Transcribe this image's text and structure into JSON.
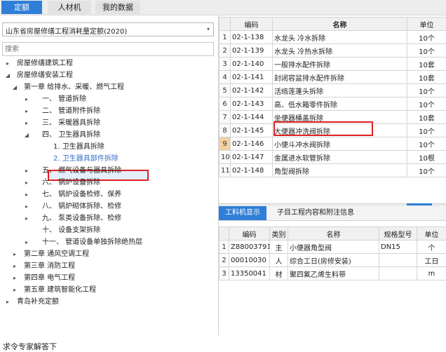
{
  "top_tabs": [
    "定额",
    "人材机",
    "我的数据"
  ],
  "left": {
    "quota_library": "山东省房屋修缮工程消耗量定额(2020)",
    "search_placeholder": "搜索",
    "tree": [
      {
        "label": "房屋修缮建筑工程",
        "toggle": "▸"
      },
      {
        "label": "房屋修缮安装工程",
        "toggle": "◢"
      },
      {
        "label": "第一章 给排水、采暖、燃气工程",
        "toggle": "◢"
      },
      {
        "label": "一、 管道拆除",
        "toggle": "▸"
      },
      {
        "label": "二、 管道附件拆除",
        "toggle": "▸"
      },
      {
        "label": "三、 采暖器具拆除",
        "toggle": "▸"
      },
      {
        "label": "四、 卫生器具拆除",
        "toggle": "◢"
      },
      {
        "label": "1. 卫生器具拆除",
        "toggle": ""
      },
      {
        "label": "2. 卫生器具部件拆除",
        "toggle": ""
      },
      {
        "label": "五、 燃气设备与器具拆除",
        "toggle": "▸"
      },
      {
        "label": "六、 锅炉设备拆除",
        "toggle": "▸"
      },
      {
        "label": "七、 锅炉设备检修、保养",
        "toggle": "▸"
      },
      {
        "label": "八、 锅炉砌体拆除、检修",
        "toggle": "▸"
      },
      {
        "label": "九、 泵类设备拆除、检修",
        "toggle": "▸"
      },
      {
        "label": "十、 设备支架拆除",
        "toggle": ""
      },
      {
        "label": "十一、 管道设备单独拆除绝热层",
        "toggle": "▸"
      },
      {
        "label": "第二章 通风空调工程",
        "toggle": "▸"
      },
      {
        "label": "第三章 消防工程",
        "toggle": "▸"
      },
      {
        "label": "第四章 电气工程",
        "toggle": "▸"
      },
      {
        "label": "第五章 建筑智能化工程",
        "toggle": "▸"
      },
      {
        "label": "青岛补充定额",
        "toggle": "▸"
      }
    ]
  },
  "quota_table": {
    "headers": [
      "",
      "编码",
      "名称",
      "单位"
    ],
    "rows": [
      [
        "1",
        "02-1-138",
        "水龙头 冷水拆除",
        "10个"
      ],
      [
        "2",
        "02-1-139",
        "水龙头 冷热水拆除",
        "10个"
      ],
      [
        "3",
        "02-1-140",
        "一般排水配件拆除",
        "10套"
      ],
      [
        "4",
        "02-1-141",
        "封闭容盆排水配件拆除",
        "10套"
      ],
      [
        "5",
        "02-1-142",
        "活络莲蓬头拆除",
        "10个"
      ],
      [
        "6",
        "02-1-143",
        "高、低水箱零件拆除",
        "10个"
      ],
      [
        "7",
        "02-1-144",
        "坐便器桶盖拆除",
        "10套"
      ],
      [
        "8",
        "02-1-145",
        "大便器冲洗阀拆除",
        "10个"
      ],
      [
        "9",
        "02-1-146",
        "小便斗冲水阀拆除",
        "10个"
      ],
      [
        "10",
        "02-1-147",
        "金属进水软管拆除",
        "10根"
      ],
      [
        "11",
        "02-1-148",
        "角型阀拆除",
        "10个"
      ]
    ]
  },
  "sub_tabs": [
    "工料机显示",
    "子目工程内容和附注信息"
  ],
  "resource_table": {
    "headers": [
      "",
      "编码",
      "类别",
      "名称",
      "规格型号",
      "单位"
    ],
    "rows": [
      [
        "1",
        "Z88003791",
        "主",
        "小便器角型阀",
        "DN15",
        "个"
      ],
      [
        "2",
        "00010030",
        "人",
        "综合工日(房修安装)",
        "",
        "工日"
      ],
      [
        "3",
        "13350041",
        "材",
        "聚四氟乙烯生料带",
        "",
        "m"
      ]
    ]
  },
  "footer_text": "求令专家解答下",
  "colors": {
    "accent": "#2f7ed8",
    "highlight": "#e02020"
  }
}
